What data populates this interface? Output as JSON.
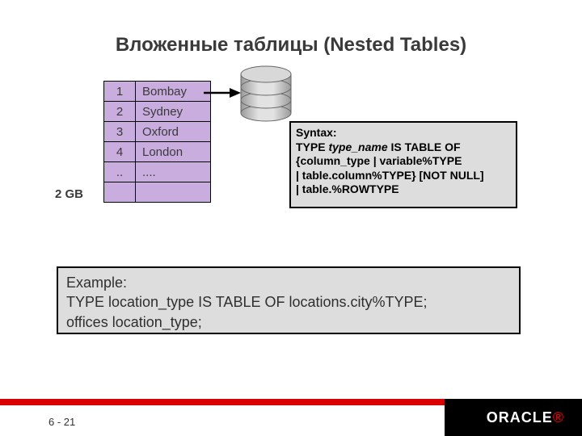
{
  "title": "Вложенные таблицы (Nested Tables)",
  "table": {
    "rows": [
      {
        "idx": "1",
        "val": "Bombay"
      },
      {
        "idx": "2",
        "val": "Sydney"
      },
      {
        "idx": "3",
        "val": "Oxford"
      },
      {
        "idx": "4",
        "val": "London"
      },
      {
        "idx": "..",
        "val": "...."
      },
      {
        "idx": "",
        "val": ""
      }
    ]
  },
  "size_label": "2 GB",
  "syntax": {
    "label": "Syntax:",
    "l1a": "TYPE ",
    "l1_type": "type_name",
    "l1b": " IS TABLE OF",
    "l2": " {column_type | variable%TYPE",
    "l3": " | table.column%TYPE} [NOT NULL]",
    "l4": " | table.%ROWTYPE"
  },
  "example": {
    "label": "Example:",
    "l1": "TYPE location_type IS TABLE OF locations.city%TYPE;",
    "l2": "offices location_type;"
  },
  "footer": {
    "page": "6 - 21",
    "logo": "ORACLE"
  }
}
